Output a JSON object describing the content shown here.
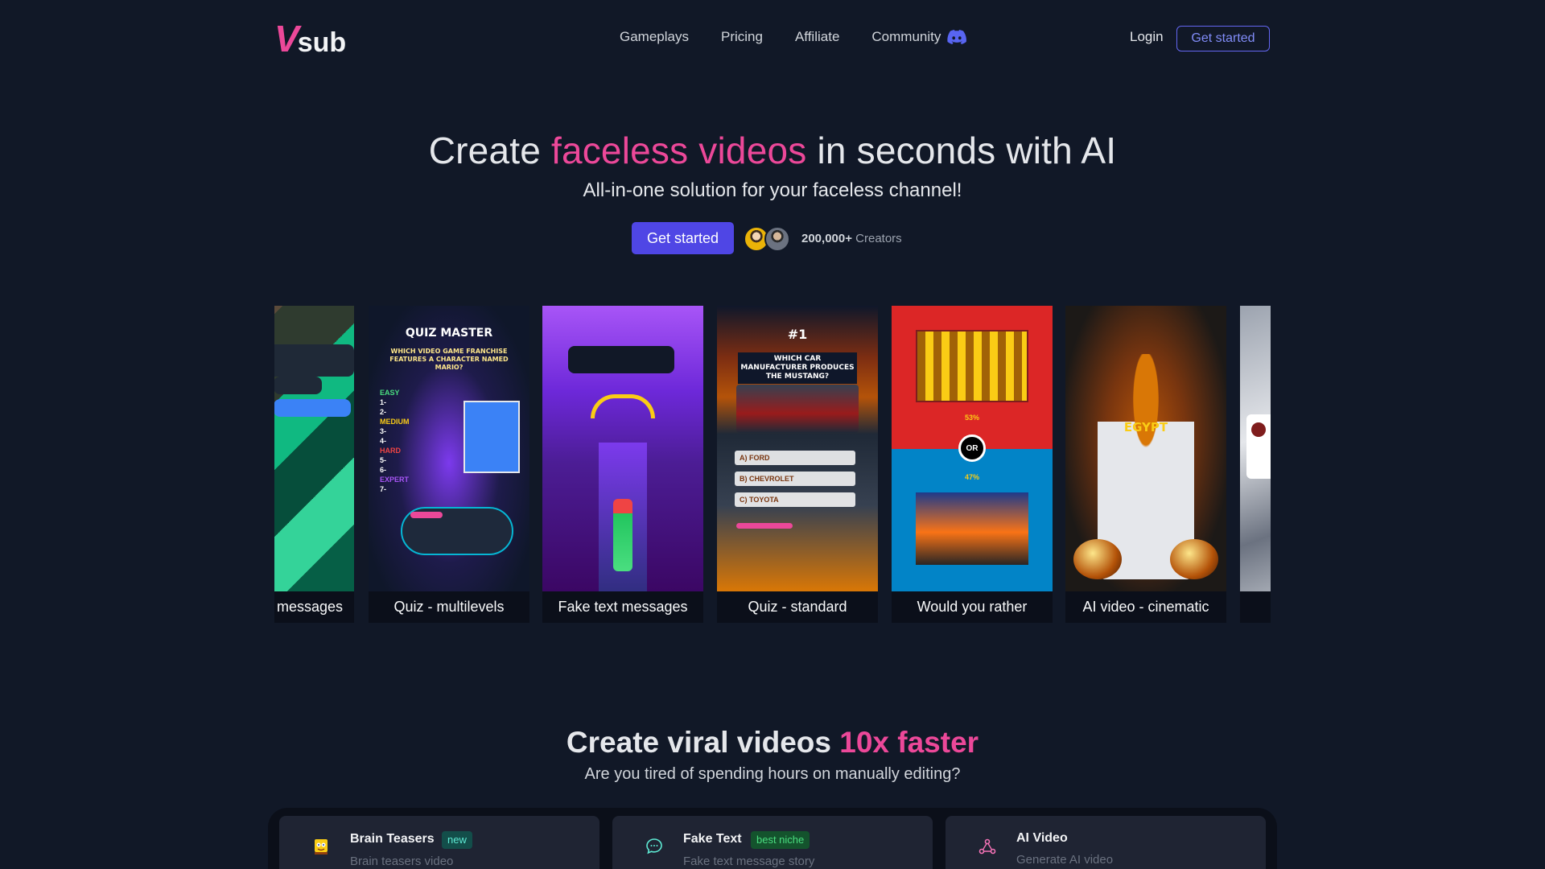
{
  "brand": {
    "logo_v": "V",
    "logo_sub": "sub",
    "accent_color": "#ec4899",
    "primary_color": "#4f46e5"
  },
  "nav": {
    "links": [
      "Gameplays",
      "Pricing",
      "Affiliate",
      "Community"
    ],
    "community_icon": "discord-icon",
    "login": "Login",
    "cta": "Get started"
  },
  "hero": {
    "title_prefix": "Create ",
    "title_accent": "faceless videos",
    "title_suffix": " in seconds with AI",
    "subtitle": "All-in-one solution for your faceless channel!",
    "cta": "Get started",
    "creators_count": "200,000+",
    "creators_label": " Creators"
  },
  "carousel": {
    "cards": [
      {
        "label": "messages"
      },
      {
        "label": "Quiz - multilevels",
        "overlay": {
          "title": "QUIZ MASTER",
          "question": "WHICH VIDEO GAME FRANCHISE FEATURES A CHARACTER NAMED MARIO?",
          "levels": [
            "EASY",
            "1-",
            "2-",
            "MEDIUM",
            "3-",
            "4-",
            "HARD",
            "5-",
            "6-",
            "EXPERT",
            "7-"
          ]
        }
      },
      {
        "label": "Fake text messages"
      },
      {
        "label": "Quiz - standard",
        "overlay": {
          "rank": "#1",
          "question": "WHICH CAR MANUFACTURER PRODUCES THE MUSTANG?",
          "options": [
            "A) FORD",
            "B) CHEVROLET",
            "C) TOYOTA"
          ]
        }
      },
      {
        "label": "Would you rather",
        "overlay": {
          "top_pct": "53%",
          "bottom_pct": "47%",
          "or": "OR"
        }
      },
      {
        "label": "AI video - cinematic",
        "overlay": {
          "caption": "EGYPT"
        }
      },
      {
        "label": ""
      }
    ]
  },
  "section2": {
    "title_prefix": "Create viral videos ",
    "title_accent": "10x faster",
    "subtitle": "Are you tired of spending hours on manually editing?",
    "features": [
      {
        "name": "Brain Teasers",
        "badge": "new",
        "desc": "Brain teasers video",
        "icon": "sponge-character-icon"
      },
      {
        "name": "Fake Text",
        "badge": "best niche",
        "desc": "Fake text message story",
        "icon": "chat-bubble-icon"
      },
      {
        "name": "AI Video",
        "badge": "",
        "desc": "Generate AI video",
        "icon": "ai-nodes-icon"
      }
    ]
  }
}
